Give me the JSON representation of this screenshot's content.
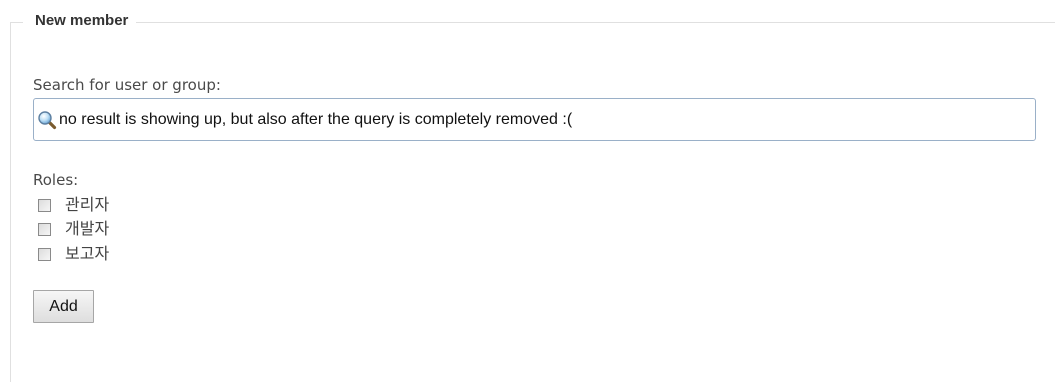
{
  "section": {
    "legend": "New member"
  },
  "search": {
    "label": "Search for user or group:",
    "value": "no result is showing up, but also after the query is completely removed :(",
    "icon": "search-icon"
  },
  "roles": {
    "label": "Roles:",
    "items": [
      {
        "label": "관리자",
        "checked": false
      },
      {
        "label": "개발자",
        "checked": false
      },
      {
        "label": "보고자",
        "checked": false
      }
    ]
  },
  "actions": {
    "add_label": "Add"
  }
}
